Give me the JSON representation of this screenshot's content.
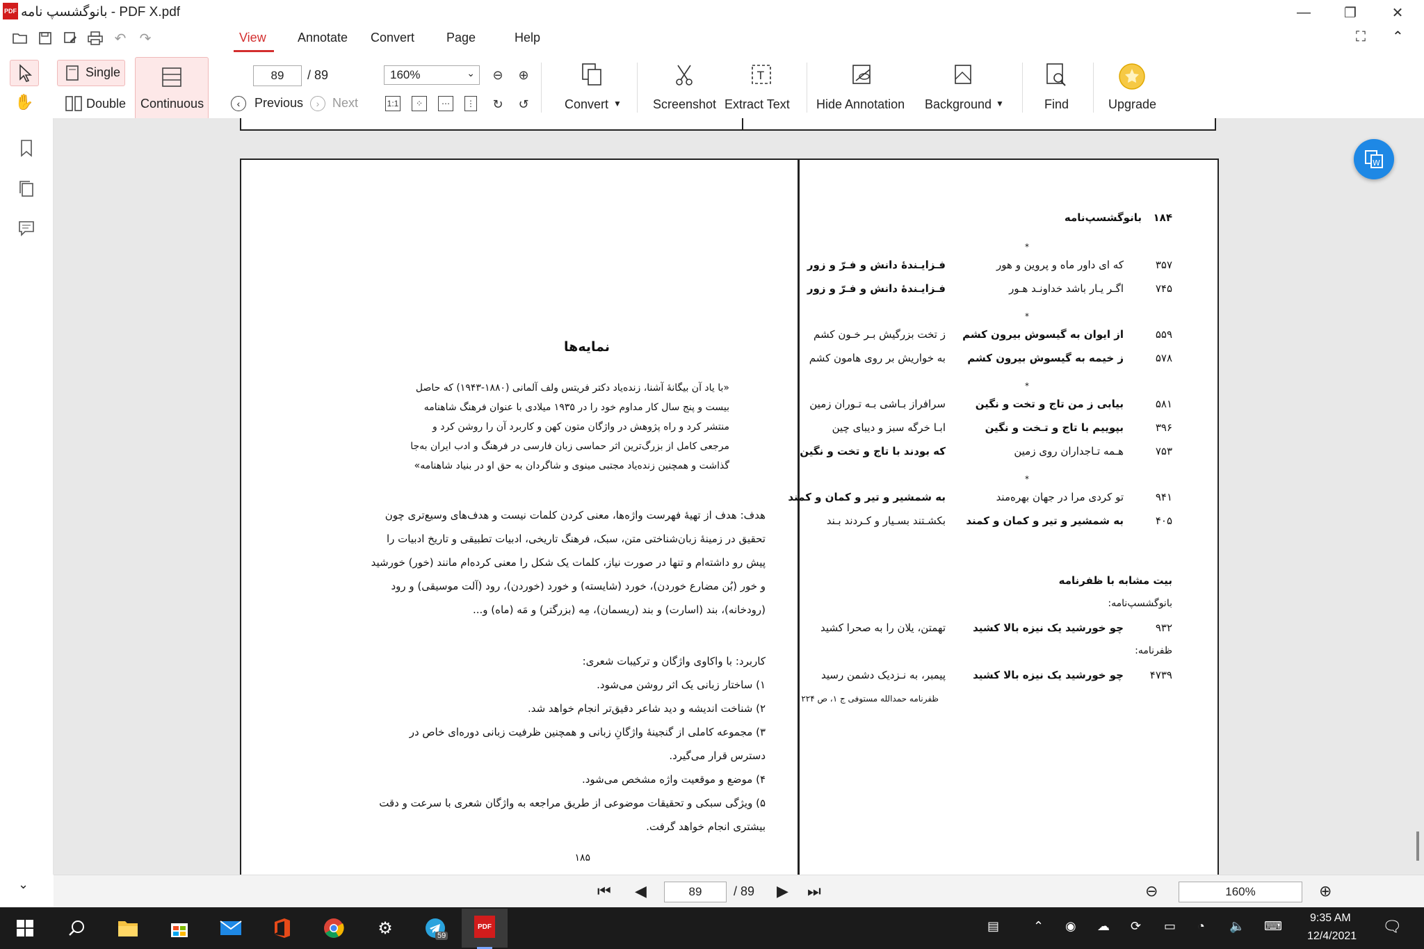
{
  "window": {
    "title": "بانوگشسپ نامه - PDF X.pdf",
    "logo_text": "PDF",
    "minimize": "—",
    "maximize": "❐",
    "close": "✕"
  },
  "menu": {
    "items": [
      "View",
      "Annotate",
      "Convert",
      "Page",
      "Help"
    ]
  },
  "toolbar": {
    "single": "Single",
    "double": "Double",
    "continuous": "Continuous",
    "page_current": "89",
    "page_total": "/ 89",
    "previous": "Previous",
    "next": "Next",
    "zoom": "160%",
    "convert": "Convert",
    "screenshot": "Screenshot",
    "extract_text": "Extract Text",
    "hide_annotation": "Hide Annotation",
    "background": "Background",
    "find": "Find",
    "upgrade": "Upgrade"
  },
  "left_page": {
    "heading": "نمایه‌ها",
    "dedication": [
      "«با یاد آن بیگانهٔ آشنا، زنده‌یاد دکتر فریتس ولف آلمانی (۱۸۸۰-۱۹۴۳) که حاصل",
      "بیست و پنج سال کار مداوم خود را در ۱۹۳۵ میلادی با عنوان فرهنگ شاهنامه",
      "منتشر کرد و راه پژوهش در واژگان متون کهن و کاربرد آن را روشن کرد و",
      "مرجعی کامل از بزرگ‌ترین اثر حماسی زبان فارسی در فرهنگ و ادب ایران به‌جا",
      "گذاشت و همچنین زنده‌یاد مجتبی مینوی و شاگردان به حق او در بنیاد شاهنامه»"
    ],
    "goal_label": "هدف:",
    "goal": [
      "هدف: هدف از تهیهٔ فهرست واژه‌ها، معنی کردن کلمات نیست و هدف‌های وسیع‌تری چون",
      "تحقیق در زمینهٔ زبان‌شناختی متن، سبک، فرهنگ تاریخی، ادبیات تطبیقی و تاریخ ادبیات را",
      "پیش رو داشته‌ام و تنها در صورت نیاز، کلمات یک شکل را معنی کرده‌ام مانند (خور) خورشید",
      "و خور (بُن مضارع خوردن)، خورد (شایسته) و خورد (خوردن)، رود (آلت موسیقی) و رود",
      "(رودخانه)، بند (اسارت) و بند (ریسمان)، مِه (بزرگتر) و مَه (ماه) و..."
    ],
    "usage": [
      "کاربرد: با واکاوی واژگان و ترکیبات شعری:",
      "۱) ساختار زبانی یک اثر روشن می‌شود.",
      "۲) شناخت اندیشه و دید شاعر دقیق‌تر انجام خواهد شد.",
      "۳) مجموعه کاملی از گنجینهٔ واژگانِ زبانی و همچنین ظرفیت زبانی دوره‌ای خاص در",
      "دسترس قرار می‌گیرد.",
      "۴) موضع و موقعیت واژه مشخص می‌شود.",
      "۵) ویژگی سبکی و تحقیقات موضوعی از طریق مراجعه به واژگان شعری با سرعت و دقت",
      "بیشتری انجام خواهد گرفت."
    ],
    "page_number": "۱۸۵"
  },
  "right_page": {
    "header_num": "۱۸۴",
    "header_title": "بانوگشسپ‌نامه",
    "star": "*",
    "groups": [
      [
        {
          "num": "۳۵۷",
          "first": "که ای داور ماه و پروین و هور",
          "second": "فـزایـندهٔ دانش و فـرّ و زور",
          "b1": false,
          "b2": true
        },
        {
          "num": "۷۴۵",
          "first": "اگـر یـار باشد خداونـد هـور",
          "second": "فـزایـندهٔ دانش و فـرّ و زور",
          "b1": false,
          "b2": true
        }
      ],
      [
        {
          "num": "۵۵۹",
          "first": "از ایوان به گیسوش بیرون کشم",
          "second": "ز تخت بزرگیش بـر خـون کشم",
          "b1": true,
          "b2": false
        },
        {
          "num": "۵۷۸",
          "first": "ز خیمه به گیسوش بیرون کشم",
          "second": "به خواریش بر روی هامون کشم",
          "b1": true,
          "b2": false
        }
      ],
      [
        {
          "num": "۵۸۱",
          "first": "بیابی ز من تاج و تخت و نگین",
          "second": "سرافراز بـاشی بـه تـوران زمین",
          "b1": true,
          "b2": false
        },
        {
          "num": "۳۹۶",
          "first": "بپوییم با تاج و تـخت و نگین",
          "second": "ابـا خرگه سبز و دیبای چین",
          "b1": true,
          "b2": false
        },
        {
          "num": "۷۵۳",
          "first": "هـمه تـاجداران روی زمین",
          "second": "که بودند با تاج و تخت و نگین",
          "b1": false,
          "b2": true
        }
      ],
      [
        {
          "num": "۹۴۱",
          "first": "تو کردی مرا در جهان بهره‌مند",
          "second": "به شمشیر و تیر و کمان و کمند",
          "b1": false,
          "b2": true
        },
        {
          "num": "۴۰۵",
          "first": "به شمشیر و تیر و کمان و کمند",
          "second": "بکشـتند بسـیار و کـردند بـند",
          "b1": true,
          "b2": false
        }
      ]
    ],
    "similar_title": "بیت مشابه با ظفرنامه",
    "banu_label": "بانوگشسپ‌نامه:",
    "banu_verse": {
      "num": "۹۳۲",
      "first": "چو خورشید یک نیزه بالا کشید",
      "second": "تهمتن، یلان را به صحرا کشید"
    },
    "zafar_label": "ظفرنامه:",
    "zafar_verse": {
      "num": "۴۷۳۹",
      "first": "چو خورشید یک نیزه بالا کشید",
      "second": "پیمبر، به نـزدیک دشمن رسید"
    },
    "footnote": "ظفرنامه حمدالله مستوفی ج ۱، ص ۲۲۴"
  },
  "bottom_nav": {
    "page_current": "89",
    "page_total": "/ 89",
    "zoom": "160%"
  },
  "taskbar": {
    "telegram_badge": "59",
    "time": "9:35 AM",
    "date": "12/4/2021"
  },
  "colors": {
    "accent": "#d32f2f",
    "active_bg": "#fde8e8",
    "doc_bg": "#e8e8e8",
    "taskbar": "#1b1b1b",
    "float_btn": "#1e88e5"
  }
}
